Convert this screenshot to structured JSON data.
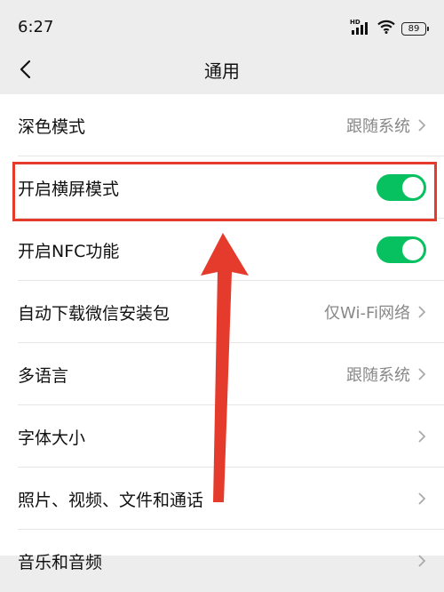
{
  "status_bar": {
    "time": "6:27",
    "network_label": "HD",
    "battery_level": "89",
    "icons": [
      "hd-signal-icon",
      "wifi-icon",
      "battery-icon"
    ]
  },
  "nav": {
    "title": "通用",
    "back_icon": "chevron-left-icon"
  },
  "settings": [
    {
      "label": "深色模式",
      "value": "跟随系统",
      "type": "link"
    },
    {
      "label": "开启横屏模式",
      "type": "toggle",
      "on": true
    },
    {
      "label": "开启NFC功能",
      "type": "toggle",
      "on": true
    },
    {
      "label": "自动下载微信安装包",
      "value": "仅Wi-Fi网络",
      "type": "link"
    },
    {
      "label": "多语言",
      "value": "跟随系统",
      "type": "link"
    },
    {
      "label": "字体大小",
      "type": "link"
    },
    {
      "label": "照片、视频、文件和通话",
      "type": "link"
    },
    {
      "label": "音乐和音频",
      "type": "link"
    }
  ],
  "colors": {
    "toggle_on": "#07c160",
    "annotation": "#e53b2c",
    "background": "#ededed"
  }
}
